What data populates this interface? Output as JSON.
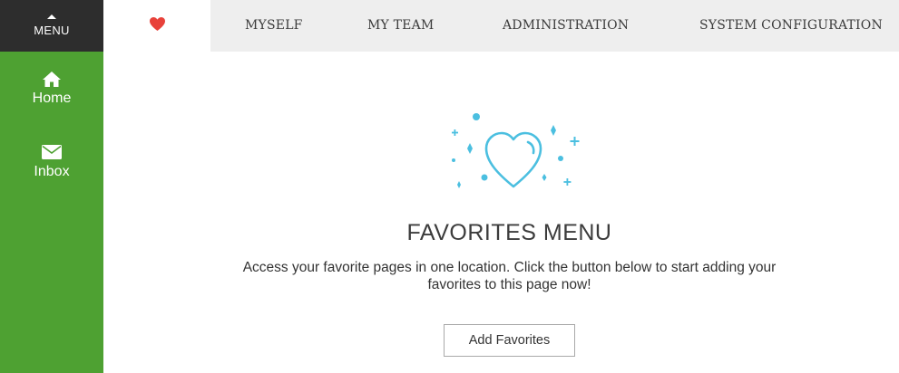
{
  "sidebar": {
    "menu_label": "MENU",
    "items": [
      {
        "label": "Home",
        "icon": "home-icon"
      },
      {
        "label": "Inbox",
        "icon": "envelope-icon"
      }
    ],
    "background": "#4ea132",
    "menu_background": "#2d2d2d"
  },
  "topnav": {
    "favorites_icon": "heart-icon",
    "favorites_color": "#e8413a",
    "items": [
      {
        "label": "MYSELF"
      },
      {
        "label": "MY TEAM"
      },
      {
        "label": "ADMINISTRATION"
      },
      {
        "label": "SYSTEM CONFIGURATION"
      }
    ],
    "background": "#eeeeee"
  },
  "main": {
    "illustration_icon": "sparkling-heart-icon",
    "illustration_color": "#4bbfe0",
    "title": "FAVORITES MENU",
    "description": "Access your favorite pages in one location. Click the button below to start adding your favorites to this page now!",
    "button_label": "Add Favorites"
  }
}
